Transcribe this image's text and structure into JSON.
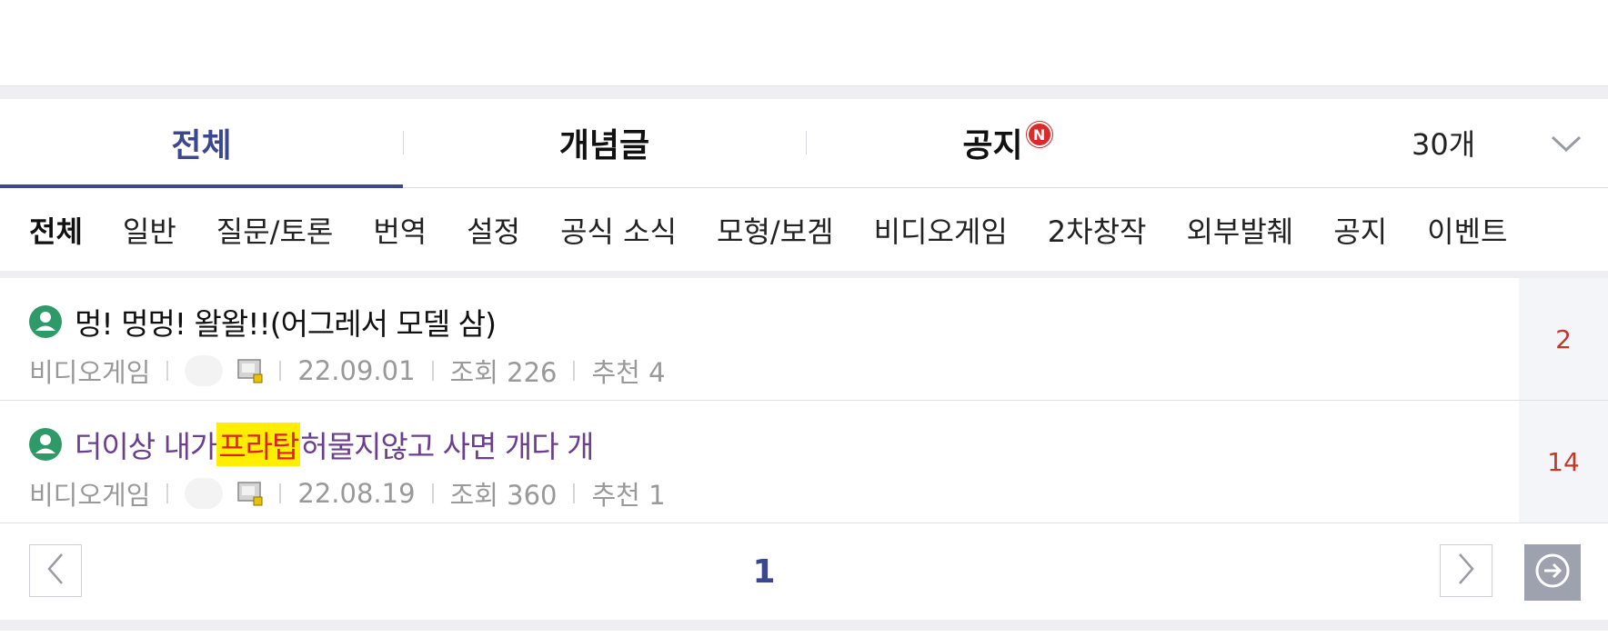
{
  "main_tabs": [
    {
      "label": "전체"
    },
    {
      "label": "개념글"
    },
    {
      "label": "공지",
      "badge": "N"
    }
  ],
  "post_count": "30개",
  "categories": [
    "전체",
    "일반",
    "질문/토론",
    "번역",
    "설정",
    "공식 소식",
    "모형/보겜",
    "비디오게임",
    "2차창작",
    "외부발췌",
    "공지",
    "이벤트"
  ],
  "posts": [
    {
      "title": "멍! 멍멍! 왈왈!!(어그레서 모델 삼)",
      "category": "비디오게임",
      "date": "22.09.01",
      "views": "조회 226",
      "likes": "추천 4",
      "comments": "2"
    },
    {
      "title_before": "더이상 내가 ",
      "title_highlight": "프라탑",
      "title_after": " 허물지않고 사면 개다 개",
      "category": "비디오게임",
      "date": "22.08.19",
      "views": "조회 360",
      "likes": "추천 1",
      "comments": "14"
    }
  ],
  "pagination": {
    "current": "1"
  },
  "colors": {
    "accent": "#3b4890",
    "comment_count": "#c0392b",
    "highlight_bg": "#ffee00",
    "highlight_text": "#e02020",
    "visited_title": "#6a3f8e"
  }
}
